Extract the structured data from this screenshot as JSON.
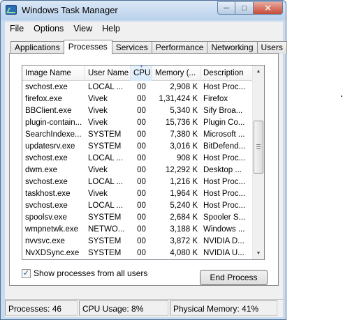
{
  "window": {
    "title": "Windows Task Manager"
  },
  "window_controls": {
    "minimize": "─",
    "maximize": "□",
    "close": "✕"
  },
  "menu": [
    "File",
    "Options",
    "View",
    "Help"
  ],
  "tabs": [
    "Applications",
    "Processes",
    "Services",
    "Performance",
    "Networking",
    "Users"
  ],
  "active_tab": "Processes",
  "table": {
    "columns": [
      "Image Name",
      "User Name",
      "CPU",
      "Memory (...",
      "Description"
    ],
    "sorted_column": "CPU",
    "rows": [
      [
        "svchost.exe",
        "LOCAL ...",
        "00",
        "2,908 K",
        "Host Proc..."
      ],
      [
        "firefox.exe",
        "Vivek",
        "00",
        "1,31,424 K",
        "Firefox"
      ],
      [
        "BBClient.exe",
        "Vivek",
        "00",
        "5,340 K",
        "Sify Broa..."
      ],
      [
        "plugin-contain...",
        "Vivek",
        "00",
        "15,736 K",
        "Plugin Co..."
      ],
      [
        "SearchIndexe...",
        "SYSTEM",
        "00",
        "7,380 K",
        "Microsoft ..."
      ],
      [
        "updatesrv.exe",
        "SYSTEM",
        "00",
        "3,016 K",
        "BitDefend..."
      ],
      [
        "svchost.exe",
        "LOCAL ...",
        "00",
        "908 K",
        "Host Proc..."
      ],
      [
        "dwm.exe",
        "Vivek",
        "00",
        "12,292 K",
        "Desktop ..."
      ],
      [
        "svchost.exe",
        "LOCAL ...",
        "00",
        "1,216 K",
        "Host Proc..."
      ],
      [
        "taskhost.exe",
        "Vivek",
        "00",
        "1,964 K",
        "Host Proc..."
      ],
      [
        "svchost.exe",
        "LOCAL ...",
        "00",
        "5,240 K",
        "Host Proc..."
      ],
      [
        "spoolsv.exe",
        "SYSTEM",
        "00",
        "2,684 K",
        "Spooler S..."
      ],
      [
        "wmpnetwk.exe",
        "NETWO...",
        "00",
        "3,188 K",
        "Windows ..."
      ],
      [
        "nvvsvc.exe",
        "SYSTEM",
        "00",
        "3,872 K",
        "NVIDIA D..."
      ],
      [
        "NvXDSync.exe",
        "SYSTEM",
        "00",
        "4,080 K",
        "NVIDIA U..."
      ]
    ]
  },
  "show_all_processes": {
    "label": "Show processes from all users",
    "checked": true,
    "mark": "✓"
  },
  "end_process_label": "End Process",
  "status": {
    "processes": "Processes: 46",
    "cpu": "CPU Usage: 8%",
    "memory": "Physical Memory: 41%"
  }
}
